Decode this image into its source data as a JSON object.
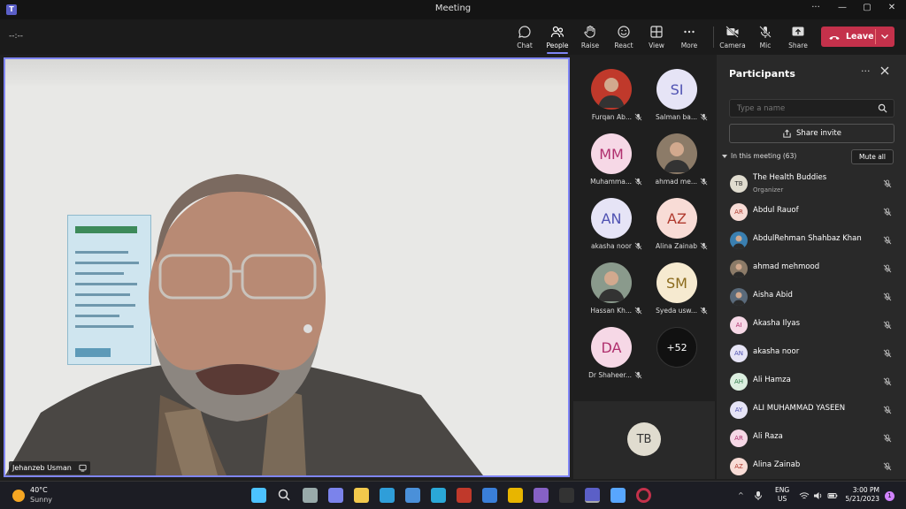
{
  "window": {
    "title": "Meeting",
    "controls": [
      "···",
      "—",
      "▢",
      "✕"
    ]
  },
  "toolbar": {
    "timer": "--:--",
    "buttons": [
      {
        "label": "Chat",
        "icon": "chat-icon"
      },
      {
        "label": "People",
        "icon": "people-icon",
        "active": true
      },
      {
        "label": "Raise",
        "icon": "raise-hand-icon"
      },
      {
        "label": "React",
        "icon": "react-icon"
      },
      {
        "label": "View",
        "icon": "view-icon"
      },
      {
        "label": "More",
        "icon": "more-icon"
      },
      {
        "label": "Camera",
        "icon": "camera-icon"
      },
      {
        "label": "Mic",
        "icon": "mic-off-icon"
      },
      {
        "label": "Share",
        "icon": "share-icon"
      }
    ],
    "leave_label": "Leave",
    "leave_color": "#c4314b"
  },
  "main_video": {
    "speaker_name": "Jehanzeb Usman",
    "border_color": "#7f85f5"
  },
  "gallery": {
    "tiles": [
      {
        "initials": "",
        "name": "Furqan Ab...",
        "photo": true,
        "bg": "#c0392b"
      },
      {
        "initials": "SI",
        "name": "Salman ba...",
        "bg": "#e6e4f6",
        "fg": "#4f52b2"
      },
      {
        "initials": "MM",
        "name": "Muhamma...",
        "bg": "#f6d8e6",
        "fg": "#b0306e"
      },
      {
        "initials": "",
        "name": "ahmad me...",
        "photo": true,
        "bg": "#8c7b68"
      },
      {
        "initials": "AN",
        "name": "akasha noor",
        "bg": "#e6e4f6",
        "fg": "#4f52b2"
      },
      {
        "initials": "AZ",
        "name": "Alina Zainab",
        "bg": "#f8dcd6",
        "fg": "#b03a2e"
      },
      {
        "initials": "",
        "name": "Hassan Kh...",
        "photo": true,
        "bg": "#8a9a8c"
      },
      {
        "initials": "SM",
        "name": "Syeda usw...",
        "bg": "#f6ead0",
        "fg": "#8a6a1c"
      },
      {
        "initials": "DA",
        "name": "Dr Shaheer...",
        "bg": "#f6d8e6",
        "fg": "#b0306e"
      },
      {
        "initials": "+52",
        "name": "",
        "overflow": true,
        "bg": "#111111",
        "fg": "#ffffff"
      }
    ],
    "self_initials": "TB"
  },
  "participants": {
    "title": "Participants",
    "search_placeholder": "Type a name",
    "share_invite": "Share invite",
    "in_meeting": "In this meeting (63)",
    "mute_all": "Mute all",
    "list": [
      {
        "initials": "TB",
        "name": "The Health Buddies",
        "role": "Organizer",
        "bg": "#e0dccf",
        "fg": "#333333"
      },
      {
        "initials": "AR",
        "name": "Abdul Rauof",
        "bg": "#f8dcd6",
        "fg": "#b03a2e"
      },
      {
        "initials": "",
        "name": "AbdulRehman Shahbaz Khan",
        "photo": true,
        "bg": "#3a7fb0"
      },
      {
        "initials": "",
        "name": "ahmad mehmood",
        "photo": true,
        "bg": "#8c7b68"
      },
      {
        "initials": "",
        "name": "Aisha Abid",
        "photo": true,
        "bg": "#5a6a7a"
      },
      {
        "initials": "AI",
        "name": "Akasha Ilyas",
        "bg": "#f6d8e6",
        "fg": "#b0306e"
      },
      {
        "initials": "AN",
        "name": "akasha noor",
        "bg": "#e6e4f6",
        "fg": "#4f52b2"
      },
      {
        "initials": "AH",
        "name": "Ali Hamza",
        "bg": "#dcefe0",
        "fg": "#2e7d4a"
      },
      {
        "initials": "AY",
        "name": "ALI MUHAMMAD YASEEN",
        "bg": "#e6e4f6",
        "fg": "#4f52b2"
      },
      {
        "initials": "AR",
        "name": "Ali Raza",
        "bg": "#f6d8e6",
        "fg": "#b0306e"
      },
      {
        "initials": "AZ",
        "name": "Alina Zainab",
        "bg": "#f8dcd6",
        "fg": "#b03a2e"
      }
    ]
  },
  "taskbar": {
    "weather_temp": "40°C",
    "weather_cond": "Sunny",
    "lang_line1": "ENG",
    "lang_line2": "US",
    "time": "3:00 PM",
    "date": "5/21/2023",
    "notif_count": "1",
    "apps": [
      "windows-start-icon",
      "search-icon",
      "task-view-icon",
      "teams-chat-icon",
      "file-explorer-icon",
      "edge-icon",
      "store-icon",
      "app-icon",
      "mcafee-icon",
      "app-icon",
      "chrome-icon",
      "visual-studio-icon",
      "terminal-icon",
      "teams-icon",
      "notepad-icon",
      "record-icon"
    ]
  }
}
